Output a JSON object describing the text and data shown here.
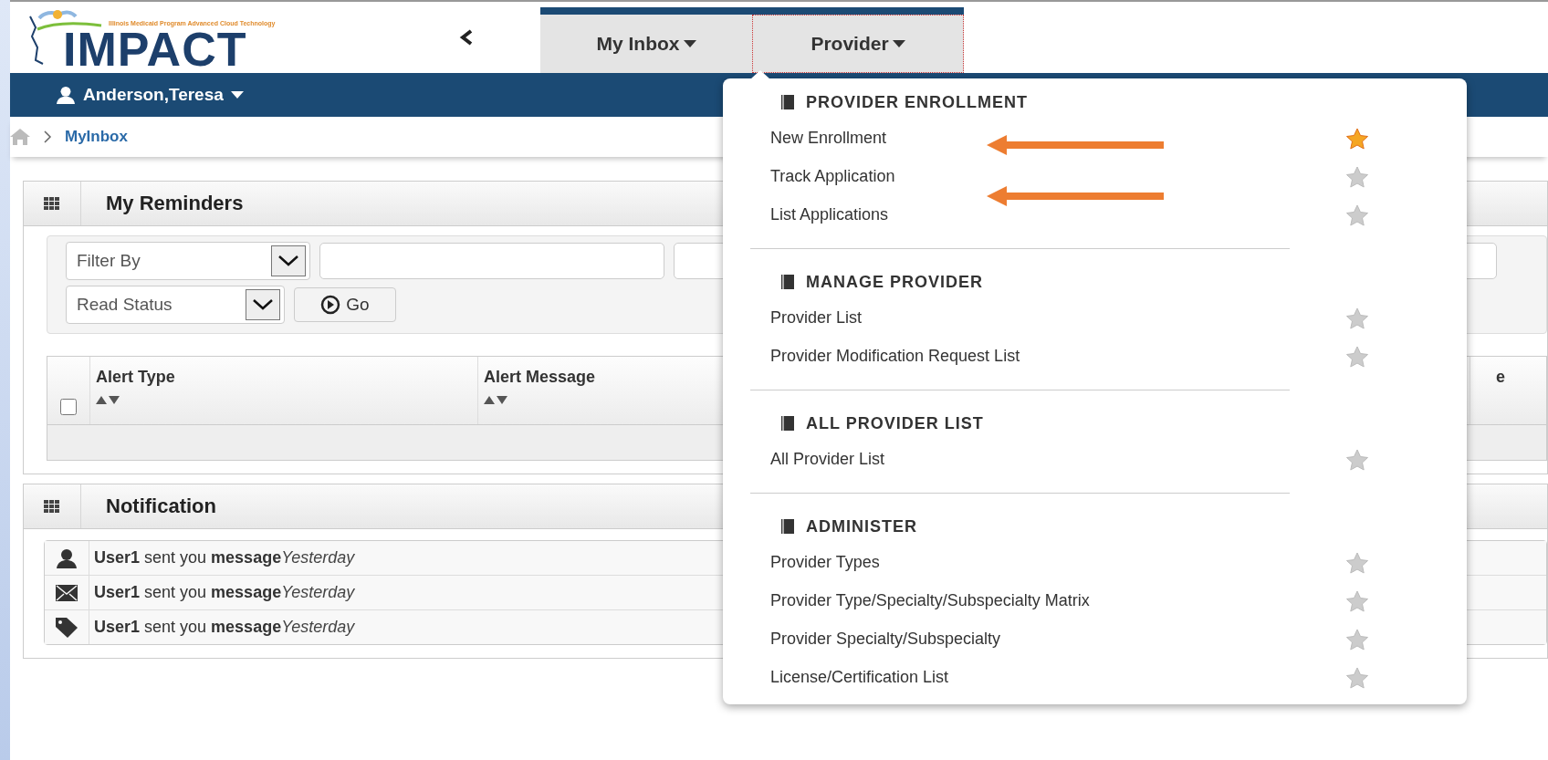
{
  "logo": {
    "tagline": "Illinois Medicaid Program Advanced Cloud Technology",
    "name": "IMPACT"
  },
  "nav_tabs": [
    {
      "label": "My Inbox",
      "selected": false
    },
    {
      "label": "Provider",
      "selected": true
    }
  ],
  "user_menu": {
    "label": "Anderson,Teresa"
  },
  "breadcrumb": {
    "current": "MyInbox"
  },
  "reminders": {
    "title": "My Reminders",
    "filter_select": "Filter By",
    "status_select": "Read Status",
    "go_button": "Go",
    "table": {
      "columns": [
        {
          "label": "Alert Type",
          "sort_arrows": true
        },
        {
          "label": "Alert Message",
          "sort_arrows": true
        },
        {
          "label": "e",
          "sort_arrows": false
        }
      ],
      "select_all_checked": false
    }
  },
  "notifications": {
    "title": "Notification",
    "items": [
      {
        "kind": "user",
        "text": "**User1** sent you **message**",
        "time": "Yesterday"
      },
      {
        "kind": "mail",
        "text": "**User1** sent you **message**",
        "time": "Yesterday"
      },
      {
        "kind": "tag",
        "text": "**User1** sent you **message**",
        "time": "Yesterday"
      }
    ]
  },
  "provider_menu": {
    "sections": [
      {
        "title": "PROVIDER ENROLLMENT",
        "items": [
          {
            "label": "New Enrollment",
            "favorite": true,
            "arrow_beside": true
          },
          {
            "label": "Track Application",
            "favorite": false,
            "arrow_below": true
          },
          {
            "label": "List Applications",
            "favorite": false
          }
        ]
      },
      {
        "title": "MANAGE PROVIDER",
        "items": [
          {
            "label": "Provider List",
            "favorite": false
          },
          {
            "label": "Provider Modification Request List",
            "favorite": false
          }
        ]
      },
      {
        "title": "ALL PROVIDER LIST",
        "items": [
          {
            "label": "All Provider List",
            "favorite": false
          }
        ]
      },
      {
        "title": "ADMINISTER",
        "items": [
          {
            "label": "Provider Types",
            "favorite": false
          },
          {
            "label": "Provider Type/Specialty/Subspecialty Matrix",
            "favorite": false
          },
          {
            "label": "Provider Specialty/Subspecialty",
            "favorite": false
          },
          {
            "label": "License/Certification List",
            "favorite": false
          }
        ]
      }
    ]
  }
}
